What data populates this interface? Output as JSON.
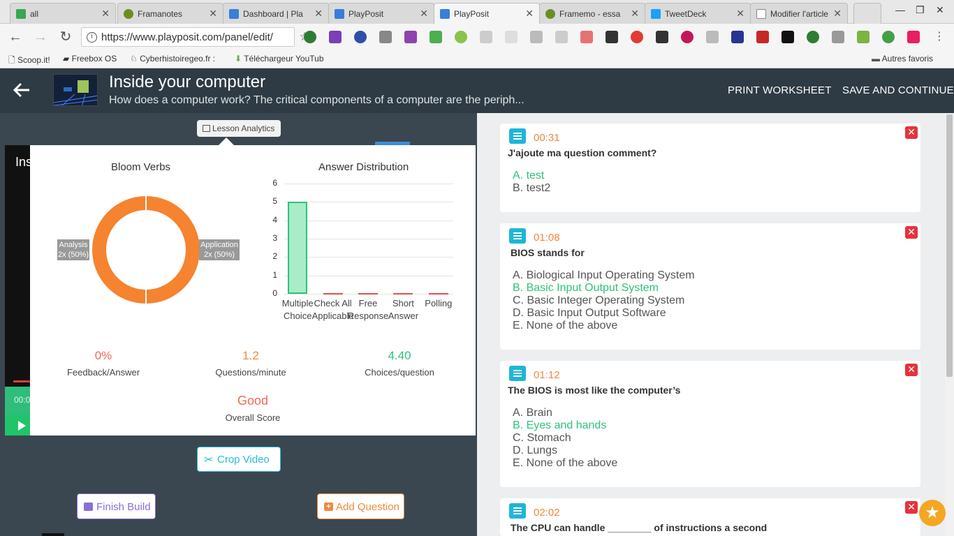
{
  "browser": {
    "tabs": [
      {
        "label": "all",
        "color": "#34a853"
      },
      {
        "label": "Framanotes",
        "color": "#6b8e23"
      },
      {
        "label": "Dashboard | Pla",
        "color": "#3b7dd8"
      },
      {
        "label": "PlayPosit",
        "color": "#3b7dd8"
      },
      {
        "label": "PlayPosit",
        "color": "#3b7dd8"
      },
      {
        "label": "Framemo - essa",
        "color": "#6b8e23"
      },
      {
        "label": "TweetDeck",
        "color": "#1da1f2"
      },
      {
        "label": "Modifier l'article",
        "color": "#888888"
      }
    ],
    "url": "https://www.playposit.com/panel/edit/",
    "bookmarks": [
      "Scoop.it!",
      "Freebox OS",
      "Cyberhistoiregeo.fr :",
      "Téléchargeur YouTub",
      "Autres favoris"
    ]
  },
  "header": {
    "title": "Inside your computer",
    "description": "How does a computer work? The critical components of a computer are the periph...",
    "print_worksheet": "PRINT WORKSHEET",
    "save_continue": "SAVE AND CONTINUE"
  },
  "video": {
    "title_fragment": "Ins",
    "time_fragment": "00:0"
  },
  "analytics": {
    "pill_label": "Lesson Analytics",
    "bloom": {
      "title": "Bloom Verbs",
      "left_label": [
        "Analysis",
        "2x (50%)"
      ],
      "right_label": [
        "Application",
        "2x (50%)"
      ]
    },
    "answer_dist": {
      "title": "Answer Distribution",
      "y_ticks": [
        "6",
        "5",
        "4",
        "3",
        "2",
        "1",
        "0"
      ],
      "categories": [
        [
          "Multiple",
          "Choice"
        ],
        [
          "Check All",
          "Applicable"
        ],
        [
          "Free",
          "Response"
        ],
        [
          "Short",
          "Answer"
        ],
        [
          "Polling",
          ""
        ]
      ]
    },
    "stats": [
      {
        "value": "0%",
        "label": "Feedback/Answer",
        "color": "#f06a5a"
      },
      {
        "value": "1.2",
        "label": "Questions/minute",
        "color": "#f08a3c"
      },
      {
        "value": "4.40",
        "label": "Choices/question",
        "color": "#2ec27e"
      }
    ],
    "overall": {
      "value": "Good",
      "label": "Overall Score",
      "color": "#f06a5a"
    }
  },
  "chart_data": [
    {
      "type": "pie",
      "title": "Bloom Verbs",
      "categories": [
        "Analysis",
        "Application"
      ],
      "values": [
        2,
        2
      ],
      "percent": [
        50,
        50
      ]
    },
    {
      "type": "bar",
      "title": "Answer Distribution",
      "categories": [
        "Multiple Choice",
        "Check All Applicable",
        "Free Response",
        "Short Answer",
        "Polling"
      ],
      "values": [
        5,
        0,
        0,
        0,
        0
      ],
      "ylim": [
        0,
        6
      ]
    }
  ],
  "buttons": {
    "crop": "Crop Video",
    "finish": "Finish Build",
    "add_question": "Add Question"
  },
  "questions": [
    {
      "time": "00:31",
      "text": "J'ajoute ma question comment?",
      "choices": [
        {
          "label": "A. test",
          "correct": true
        },
        {
          "label": "B. test2",
          "correct": false
        }
      ]
    },
    {
      "time": "01:08",
      "text": "BIOS stands for",
      "choices": [
        {
          "label": "A. Biological Input Operating System",
          "correct": false
        },
        {
          "label": "B. Basic Input Output System",
          "correct": true
        },
        {
          "label": "C. Basic Integer Operating System",
          "correct": false
        },
        {
          "label": "D. Basic Input Output Software",
          "correct": false
        },
        {
          "label": "E. None of the above",
          "correct": false
        }
      ]
    },
    {
      "time": "01:12",
      "text": "The BIOS is most like the computer’s",
      "choices": [
        {
          "label": "A. Brain",
          "correct": false
        },
        {
          "label": "B. Eyes and hands",
          "correct": true
        },
        {
          "label": "C. Stomach",
          "correct": false
        },
        {
          "label": "D. Lungs",
          "correct": false
        },
        {
          "label": "E. None of the above",
          "correct": false
        }
      ]
    },
    {
      "time": "02:02",
      "text": "The CPU can handle ________ of instructions a second",
      "choices": []
    }
  ]
}
